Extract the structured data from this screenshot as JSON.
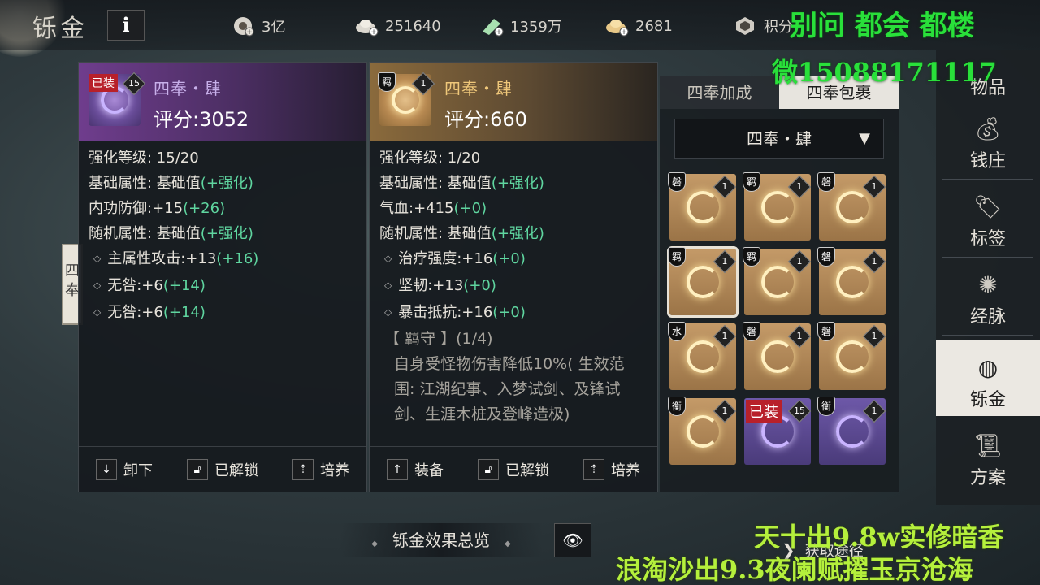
{
  "header": {
    "title": "铄金",
    "info_label": "i",
    "currencies": [
      {
        "icon": "gear-coin-icon",
        "value": "3亿"
      },
      {
        "icon": "silver-ingot-plus-icon",
        "value": "251640"
      },
      {
        "icon": "jade-plus-icon",
        "value": "1359万"
      },
      {
        "icon": "gold-ingot-plus-icon",
        "value": "2681"
      },
      {
        "icon": "points-badge-icon",
        "value": "积分"
      }
    ]
  },
  "background": {
    "scroll_text": "四奉"
  },
  "equipped_item": {
    "equipped_tag": "已装",
    "level_badge": "15",
    "name": "四奉・肆",
    "score_label": "评分:",
    "score_value": "3052",
    "enhance": "强化等级: 15/20",
    "base_header_a": "基础属性: 基础值",
    "base_header_b": "(+强化)",
    "base_stat_a": "内功防御:+15",
    "base_stat_b": "(+26)",
    "random_header_a": "随机属性: 基础值",
    "random_header_b": "(+强化)",
    "random_stats": [
      {
        "a": "主属性攻击:+13",
        "b": "(+16)"
      },
      {
        "a": "无咎:+6",
        "b": "(+14)"
      },
      {
        "a": "无咎:+6",
        "b": "(+14)"
      }
    ],
    "actions": [
      {
        "icon": "arrow-down-icon",
        "label": "卸下"
      },
      {
        "icon": "unlock-icon",
        "label": "已解锁"
      },
      {
        "icon": "cultivate-icon",
        "label": "培养"
      }
    ]
  },
  "selected_item": {
    "type_badge": "羁",
    "level_badge": "1",
    "name": "四奉・肆",
    "score_label": "评分:",
    "score_value": "660",
    "enhance": "强化等级: 1/20",
    "base_header_a": "基础属性: 基础值",
    "base_header_b": "(+强化)",
    "base_stat_a": "气血:+415",
    "base_stat_b": "(+0)",
    "random_header_a": "随机属性: 基础值",
    "random_header_b": "(+强化)",
    "random_stats": [
      {
        "a": "治疗强度:+16",
        "b": "(+0)"
      },
      {
        "a": "坚韧:+13",
        "b": "(+0)"
      },
      {
        "a": "暴击抵抗:+16",
        "b": "(+0)"
      }
    ],
    "effect_title": "【 羁守 】(1/4)",
    "effect_desc": "自身受怪物伤害降低10%( 生效范围: 江湖纪事、入梦试剑、及锋试剑、生涯木桩及登峰造极)",
    "actions": [
      {
        "icon": "arrow-up-icon",
        "label": "装备"
      },
      {
        "icon": "unlock-icon",
        "label": "已解锁"
      },
      {
        "icon": "cultivate-icon",
        "label": "培养"
      }
    ]
  },
  "inventory": {
    "tabs": [
      "四奉加成",
      "四奉包裹"
    ],
    "active_tab": 1,
    "dropdown_value": "四奉・肆",
    "slots": [
      {
        "badge": "磐",
        "count": "1",
        "color": "gold",
        "selected": false,
        "equipped": false
      },
      {
        "badge": "羁",
        "count": "1",
        "color": "gold",
        "selected": false,
        "equipped": false
      },
      {
        "badge": "磐",
        "count": "1",
        "color": "gold",
        "selected": false,
        "equipped": false
      },
      {
        "badge": "羁",
        "count": "1",
        "color": "gold",
        "selected": true,
        "equipped": false
      },
      {
        "badge": "羁",
        "count": "1",
        "color": "gold",
        "selected": false,
        "equipped": false
      },
      {
        "badge": "磐",
        "count": "1",
        "color": "gold",
        "selected": false,
        "equipped": false
      },
      {
        "badge": "水",
        "count": "1",
        "color": "gold",
        "selected": false,
        "equipped": false
      },
      {
        "badge": "磐",
        "count": "1",
        "color": "gold",
        "selected": false,
        "equipped": false
      },
      {
        "badge": "磐",
        "count": "1",
        "color": "gold",
        "selected": false,
        "equipped": false
      },
      {
        "badge": "衡",
        "count": "1",
        "color": "gold",
        "selected": false,
        "equipped": false
      },
      {
        "badge": "",
        "count": "15",
        "color": "purple",
        "selected": false,
        "equipped": true,
        "equipped_tag": "已装"
      },
      {
        "badge": "衡",
        "count": "1",
        "color": "purple",
        "selected": false,
        "equipped": false
      }
    ]
  },
  "sidebar": {
    "items": [
      {
        "icon": "item-bag-icon",
        "label": "物品"
      },
      {
        "icon": "money-bag-icon",
        "label": "钱庄"
      },
      {
        "icon": "tag-icon",
        "label": "标签"
      },
      {
        "icon": "meridian-icon",
        "label": "经脉"
      },
      {
        "icon": "swirl-icon",
        "label": "铄金"
      },
      {
        "icon": "scroll-icon",
        "label": "方案"
      }
    ],
    "active_index": 4
  },
  "footer": {
    "overview_label": "铄金效果总览",
    "acquire_label": "获取途径"
  },
  "overlay": {
    "line1": "别问 都会 都楼",
    "line2": "微15088171117",
    "line3": "天十出9.8w实修暗香",
    "line4": "浪淘沙出9.3夜阑赋擢玉京沧海"
  },
  "colors": {
    "enhance_green": "#5fd6a0",
    "equipped_red": "#b8202a",
    "overlay_green": "#29e03a",
    "overlay_yellowgreen": "#b5f03c"
  }
}
